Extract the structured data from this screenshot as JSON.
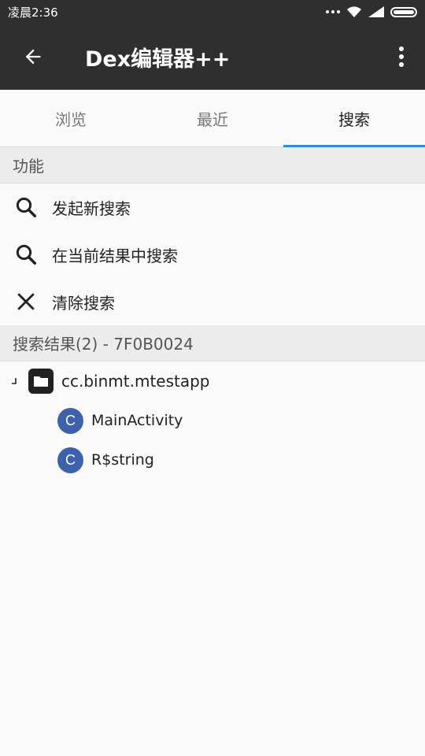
{
  "status_bar": {
    "time": "凌晨2:36"
  },
  "app_bar": {
    "title": "Dex编辑器++"
  },
  "tabs": [
    {
      "label": "浏览",
      "active": false
    },
    {
      "label": "最近",
      "active": false
    },
    {
      "label": "搜索",
      "active": true
    }
  ],
  "functions": {
    "header": "功能",
    "items": [
      {
        "label": "发起新搜索",
        "icon": "search-icon"
      },
      {
        "label": "在当前结果中搜索",
        "icon": "search-icon"
      },
      {
        "label": "清除搜索",
        "icon": "close-icon"
      }
    ]
  },
  "results": {
    "header": "搜索结果(2) - 7F0B0024",
    "root": {
      "label": "cc.binmt.mtestapp",
      "icon": "folder-icon"
    },
    "children": [
      {
        "badge": "C",
        "label": "MainActivity"
      },
      {
        "badge": "C",
        "label": "R$string"
      }
    ]
  },
  "colors": {
    "toolbar": "#2f2f2f",
    "tab_indicator": "#2b8fd9",
    "class_badge": "#3d61ad"
  }
}
